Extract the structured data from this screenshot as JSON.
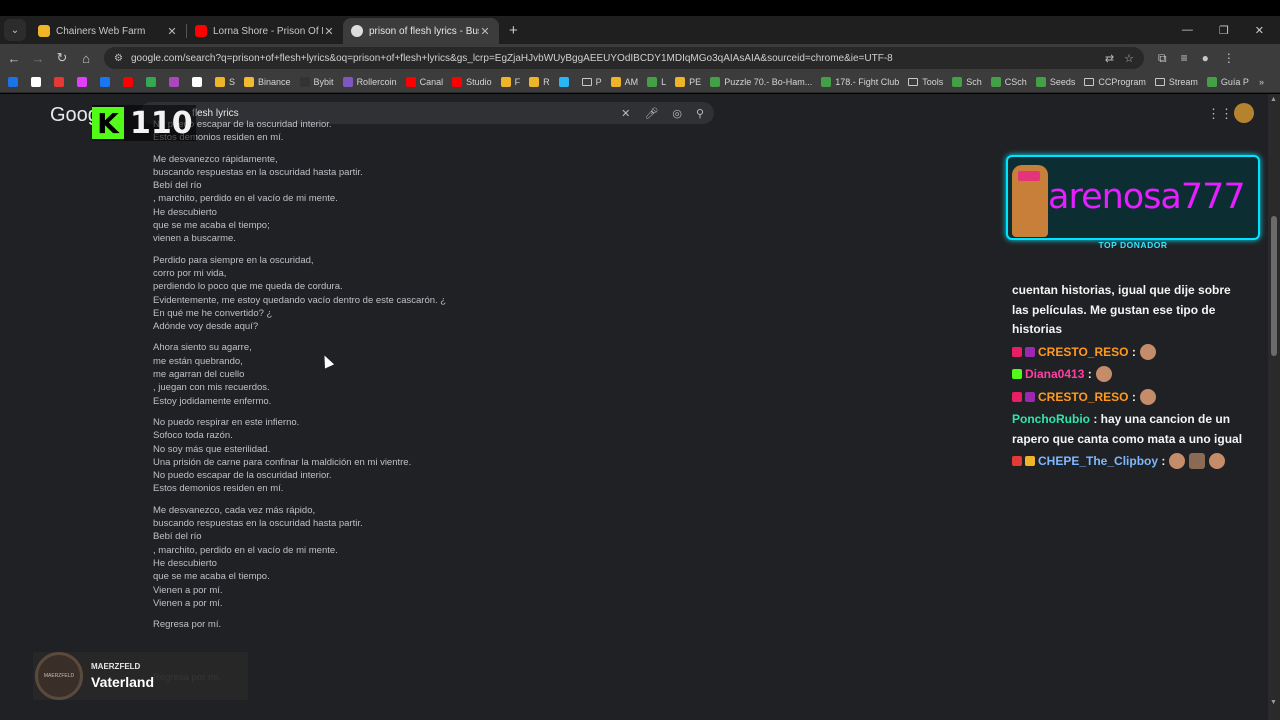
{
  "tabs": [
    {
      "title": "Chainers Web Farm",
      "favicon_color": "#f0b429"
    },
    {
      "title": "Lorna Shore - Prison Of Flesh (O",
      "favicon_color": "#ff0000"
    },
    {
      "title": "prison of flesh lyrics - Buscar co",
      "favicon_color": "#dddddd"
    }
  ],
  "toolbar": {
    "url": "google.com/search?q=prison+of+flesh+lyrics&oq=prison+of+flesh+lyrics&gs_lcrp=EgZjaHJvbWUyBggAEEUYOdIBCDY1MDIqMGo3qAIAsAIA&sourceid=chrome&ie=UTF-8"
  },
  "bookmarks": [
    {
      "label": "",
      "color": "#1a73e8"
    },
    {
      "label": "",
      "color": "#ffffff"
    },
    {
      "label": "",
      "color": "#e53935"
    },
    {
      "label": "",
      "color": "#e040fb"
    },
    {
      "label": "",
      "color": "#1877f2"
    },
    {
      "label": "",
      "color": "#ff0000"
    },
    {
      "label": "",
      "color": "#34a853"
    },
    {
      "label": "",
      "color": "#ab47bc"
    },
    {
      "label": "",
      "color": "#ffffff"
    },
    {
      "label": "S",
      "color": "#f0b429"
    },
    {
      "label": "Binance",
      "color": "#f3ba2f"
    },
    {
      "label": "Bybit",
      "color": "#333333"
    },
    {
      "label": "Rollercoin",
      "color": "#7e57c2"
    },
    {
      "label": "Canal",
      "color": "#ff0000"
    },
    {
      "label": "Studio",
      "color": "#ff0000"
    },
    {
      "label": "F",
      "color": "#f0b429"
    },
    {
      "label": "R",
      "color": "#f0b429"
    },
    {
      "label": "",
      "color": "#29b6f6"
    },
    {
      "label": "P",
      "color": "folder"
    },
    {
      "label": "AM",
      "color": "#f0b429"
    },
    {
      "label": "L",
      "color": "#43a047"
    },
    {
      "label": "PE",
      "color": "#f0b429"
    },
    {
      "label": "Puzzle 70.- Bo-Ham...",
      "color": "#43a047"
    },
    {
      "label": "178.- Fight Club",
      "color": "#43a047"
    },
    {
      "label": "Tools",
      "color": "folder"
    },
    {
      "label": "Sch",
      "color": "#43a047"
    },
    {
      "label": "CSch",
      "color": "#43a047"
    },
    {
      "label": "Seeds",
      "color": "#43a047"
    },
    {
      "label": "CCProgram",
      "color": "folder"
    },
    {
      "label": "Stream",
      "color": "folder"
    },
    {
      "label": "Guía P",
      "color": "#43a047"
    }
  ],
  "google": {
    "logo": "Goog",
    "query": "flesh lyrics"
  },
  "lyrics": [
    [
      "No puedo escapar de la oscuridad interior.",
      "Estos demonios residen en mí."
    ],
    [
      "Me desvanezco rápidamente,",
      "buscando respuestas en la oscuridad hasta partir.",
      "Bebí del río",
      ", marchito, perdido en el vacío de mi mente.",
      "He descubierto",
      "que se me acaba el tiempo;",
      "vienen a buscarme."
    ],
    [
      "Perdido para siempre en la oscuridad,",
      "corro por mi vida,",
      "perdiendo lo poco que me queda de cordura.",
      "Evidentemente, me estoy quedando vacío dentro de este cascarón. ¿",
      "En qué me he convertido? ¿",
      "Adónde voy desde aquí?"
    ],
    [
      "Ahora siento su agarre,",
      "me están quebrando,",
      "me agarran del cuello",
      ", juegan con mis recuerdos.",
      "Estoy jodidamente enfermo."
    ],
    [
      "No puedo respirar en este infierno.",
      "Sofoco toda razón.",
      "No soy más que esterilidad.",
      "Una prisión de carne para confinar la maldición en mi vientre.",
      "No puedo escapar de la oscuridad interior.",
      "Estos demonios residen en mí."
    ],
    [
      "Me desvanezco, cada vez más rápido,",
      "buscando respuestas en la oscuridad hasta partir.",
      "Bebí del río",
      ", marchito, perdido en el vacío de mi mente.",
      "He descubierto",
      "que se me acaba el tiempo.",
      "Vienen a por mí.",
      "Vienen a por mí."
    ],
    [
      "Regresa por mí.",
      "",
      "",
      "",
      "Regresa por mí."
    ]
  ],
  "overlay": {
    "kick_logo": "K",
    "viewer_count": "110",
    "top_donor_name": "arenosa777",
    "top_donor_label": "TOP DONADOR",
    "chat": [
      {
        "user": "",
        "text": "cuentan historias, igual que dije sobre las películas. Me gustan ese tipo de historias",
        "color": "#f4f4f4",
        "badges": []
      },
      {
        "user": "CRESTO_RESO",
        "text": ":",
        "color": "#ff9a1f",
        "badges": [
          "#e91e63",
          "#9c27b0"
        ],
        "emotes": 1
      },
      {
        "user": "Diana0413",
        "text": ":",
        "color": "#ff3fa4",
        "badges": [
          "#53fc18"
        ],
        "emotes": 1
      },
      {
        "user": "CRESTO_RESO",
        "text": ":",
        "color": "#ff9a1f",
        "badges": [
          "#e91e63",
          "#9c27b0"
        ],
        "emotes": 1
      },
      {
        "user": "PonchoRubio",
        "text": ": hay una cancion de un rapero que canta como mata a uno igual",
        "color": "#2ee6a8",
        "badges": []
      },
      {
        "user": "CHEPE_The_Clipboy",
        "text": ":",
        "color": "#7fb7ff",
        "badges": [
          "#e53935",
          "#f0b429"
        ],
        "emotes": 3
      }
    ],
    "music": {
      "disc_label": "MAERZFELD",
      "artist": "MAERZFELD",
      "song": "Vaterland"
    }
  }
}
